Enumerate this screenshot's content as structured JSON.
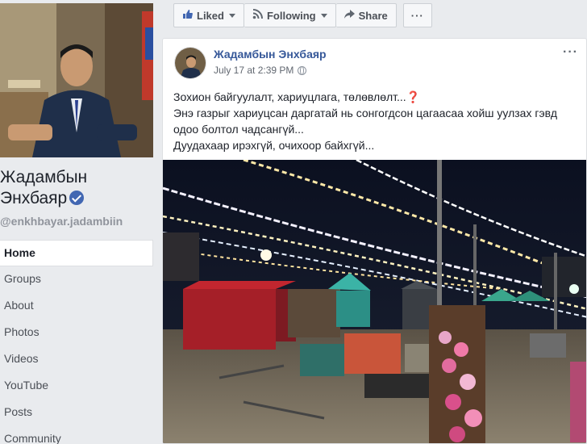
{
  "page": {
    "name": "Жадамбын Энхбаяр",
    "handle": "@enkhbayar.jadambiin"
  },
  "nav": {
    "items": [
      {
        "label": "Home",
        "active": true
      },
      {
        "label": "Groups"
      },
      {
        "label": "About"
      },
      {
        "label": "Photos"
      },
      {
        "label": "Videos"
      },
      {
        "label": "YouTube"
      },
      {
        "label": "Posts"
      },
      {
        "label": "Community"
      }
    ]
  },
  "actions": {
    "liked_label": "Liked",
    "following_label": "Following",
    "share_label": "Share",
    "more_label": "···"
  },
  "post": {
    "author": "Жадамбын Энхбаяр",
    "timestamp": "July 17 at 2:39 PM",
    "lines": [
      "Зохион байгуулалт, хариуцлага, төлөвлөлт...",
      "Энэ газрыг хариуцсан даргатай нь сонгогдсон цагаасаа хойш уулзах гэвд",
      "одоо болтол чадсангүй...",
      "Дуудахаар ирэхгүй, очихоор байхгүй..."
    ],
    "emoji": "❓",
    "more_label": "···"
  },
  "colors": {
    "link": "#365899",
    "background": "#e9ebee",
    "verified": "#4267b2"
  },
  "icons": {
    "liked": "thumbs-up-icon",
    "following": "rss-icon",
    "share": "share-arrow-icon",
    "verified": "verified-check-icon",
    "privacy": "globe-icon"
  }
}
